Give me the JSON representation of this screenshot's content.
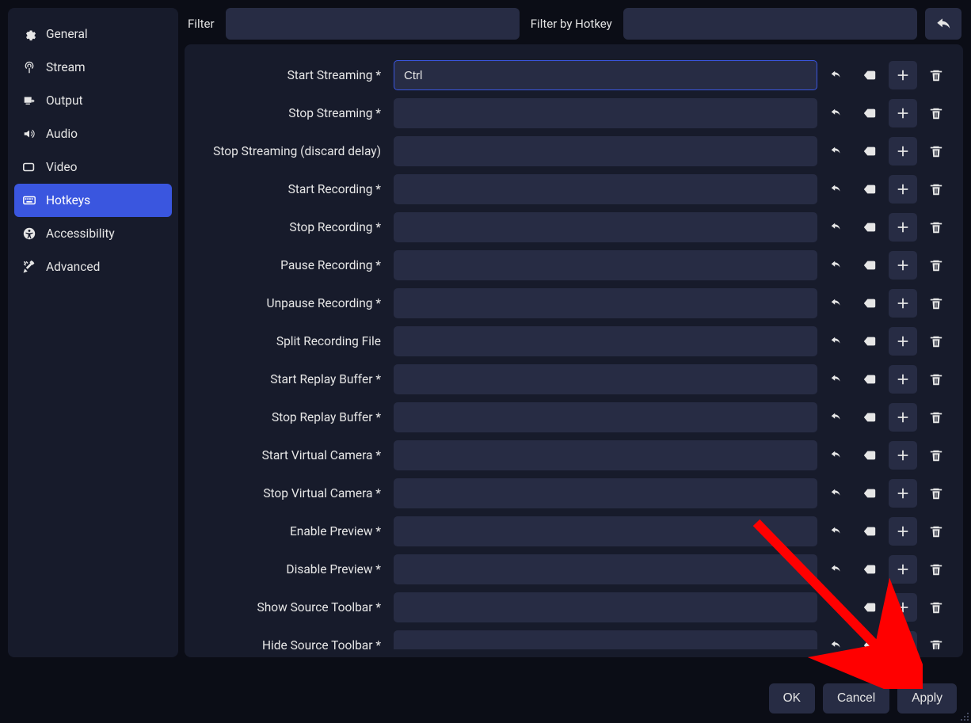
{
  "sidebar": {
    "items": [
      {
        "label": "General"
      },
      {
        "label": "Stream"
      },
      {
        "label": "Output"
      },
      {
        "label": "Audio"
      },
      {
        "label": "Video"
      },
      {
        "label": "Hotkeys"
      },
      {
        "label": "Accessibility"
      },
      {
        "label": "Advanced"
      }
    ]
  },
  "filters": {
    "filterLabel": "Filter",
    "filterByHotkeyLabel": "Filter by Hotkey",
    "filterText": "",
    "filterHotkey": ""
  },
  "hotkeys": [
    {
      "label": "Start Streaming *",
      "value": "Ctrl",
      "focused": true
    },
    {
      "label": "Stop Streaming *",
      "value": ""
    },
    {
      "label": "Stop Streaming (discard delay)",
      "value": ""
    },
    {
      "label": "Start Recording *",
      "value": ""
    },
    {
      "label": "Stop Recording *",
      "value": ""
    },
    {
      "label": "Pause Recording *",
      "value": ""
    },
    {
      "label": "Unpause Recording *",
      "value": ""
    },
    {
      "label": "Split Recording File",
      "value": ""
    },
    {
      "label": "Start Replay Buffer *",
      "value": ""
    },
    {
      "label": "Stop Replay Buffer *",
      "value": ""
    },
    {
      "label": "Start Virtual Camera *",
      "value": ""
    },
    {
      "label": "Stop Virtual Camera *",
      "value": ""
    },
    {
      "label": "Enable Preview *",
      "value": ""
    },
    {
      "label": "Disable Preview *",
      "value": ""
    },
    {
      "label": "Show Source Toolbar *",
      "value": ""
    },
    {
      "label": "Hide Source Toolbar *",
      "value": ""
    }
  ],
  "footer": {
    "ok": "OK",
    "cancel": "Cancel",
    "apply": "Apply"
  },
  "icons": {
    "revert": "revert-icon",
    "clear": "backspace-icon",
    "add": "plus-icon",
    "delete": "trash-icon"
  },
  "colors": {
    "accent": "#3a56df",
    "panel": "#171b2b",
    "input": "#272c44",
    "arrow": "#ff0000"
  }
}
